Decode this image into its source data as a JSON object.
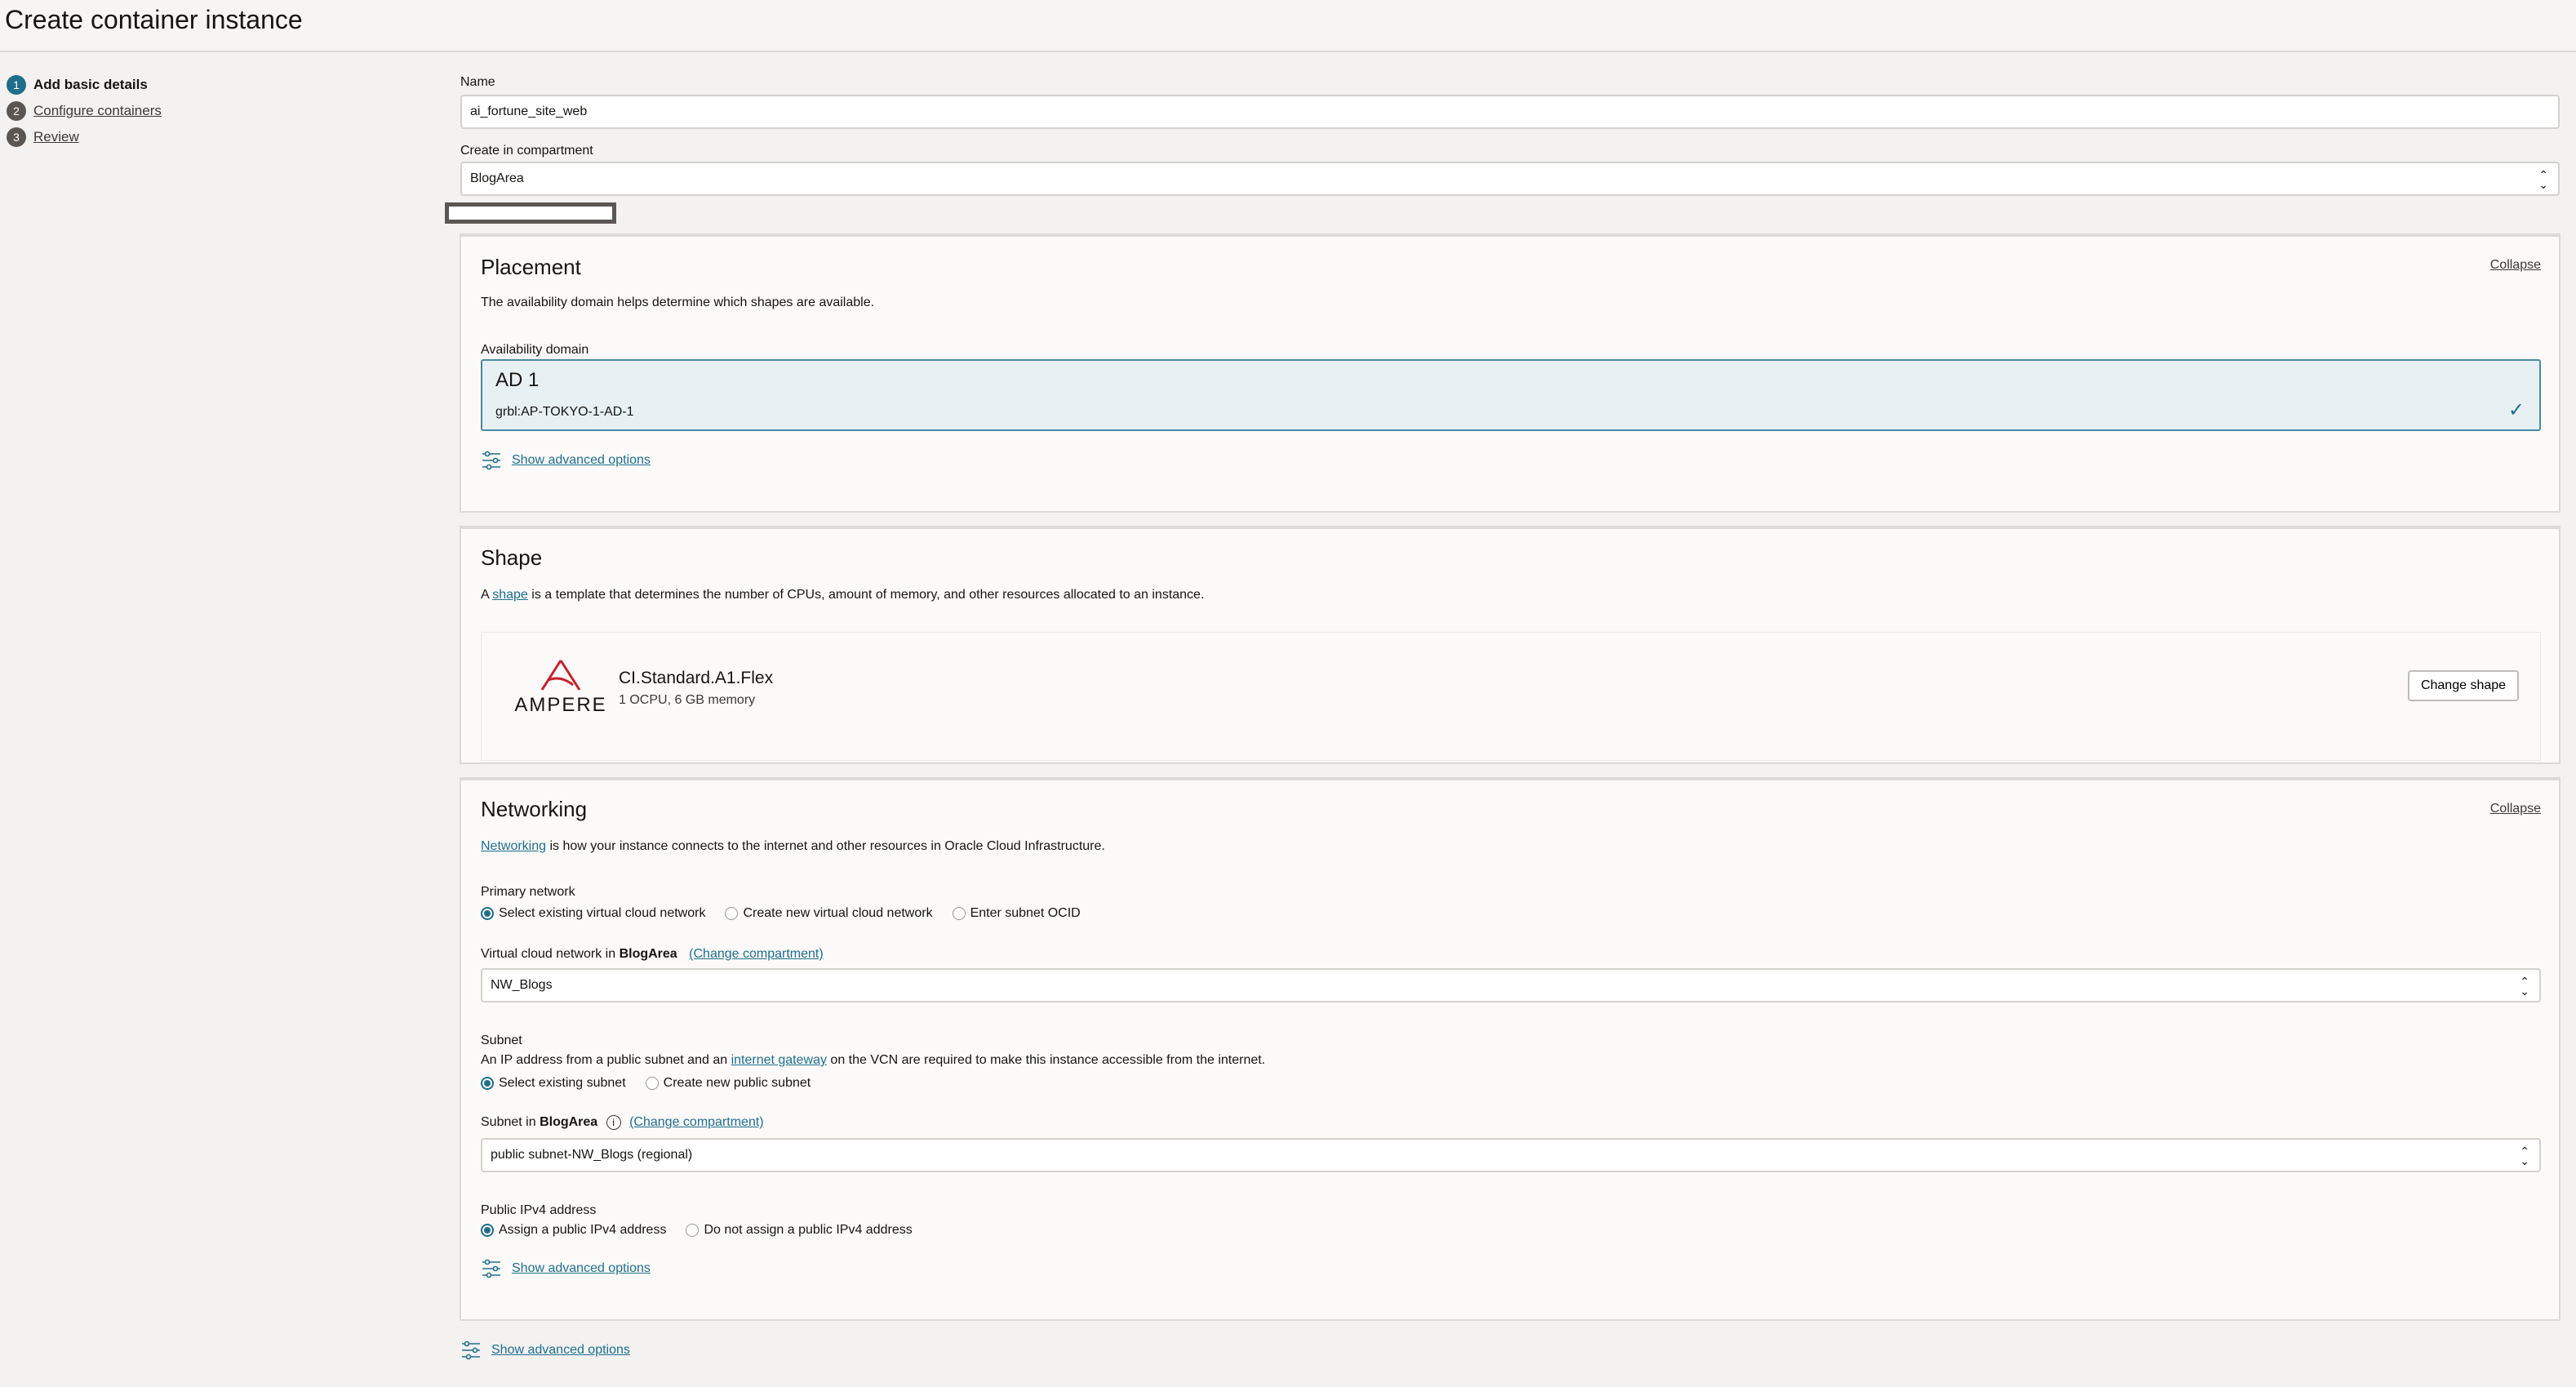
{
  "page": {
    "title": "Create container instance"
  },
  "steps": [
    {
      "num": "1",
      "label": "Add basic details"
    },
    {
      "num": "2",
      "label": "Configure containers"
    },
    {
      "num": "3",
      "label": "Review"
    }
  ],
  "form": {
    "name_label": "Name",
    "name_value": "ai_fortune_site_web",
    "compartment_label": "Create in compartment",
    "compartment_value": "BlogArea"
  },
  "placement": {
    "title": "Placement",
    "collapse": "Collapse",
    "description": "The availability domain helps determine which shapes are available.",
    "ad_label": "Availability domain",
    "ad_name": "AD 1",
    "ad_id": "grbl:AP-TOKYO-1-AD-1",
    "advanced": "Show advanced options"
  },
  "shape": {
    "title": "Shape",
    "desc_prefix": "A ",
    "desc_link": "shape",
    "desc_suffix": " is a template that determines the number of CPUs, amount of memory, and other resources allocated to an instance.",
    "logo_text": "AMPERE",
    "name": "CI.Standard.A1.Flex",
    "spec": "1 OCPU, 6 GB memory",
    "change_button": "Change shape"
  },
  "networking": {
    "title": "Networking",
    "collapse": "Collapse",
    "desc_link": "Networking",
    "desc_suffix": " is how your instance connects to the internet and other resources in Oracle Cloud Infrastructure.",
    "primary_label": "Primary network",
    "primary_options": [
      "Select existing virtual cloud network",
      "Create new virtual cloud network",
      "Enter subnet OCID"
    ],
    "vcn_label_prefix": "Virtual cloud network in ",
    "vcn_compartment": "BlogArea",
    "change_compartment": "(Change compartment)",
    "vcn_value": "NW_Blogs",
    "subnet_label": "Subnet",
    "subnet_desc_prefix": "An IP address from a public subnet and an ",
    "subnet_desc_link": "internet gateway",
    "subnet_desc_suffix": " on the VCN are required to make this instance accessible from the internet.",
    "subnet_options": [
      "Select existing subnet",
      "Create new public subnet"
    ],
    "subnet_in_prefix": "Subnet in ",
    "subnet_compartment": "BlogArea",
    "subnet_value": "public subnet-NW_Blogs (regional)",
    "ipv4_label": "Public IPv4 address",
    "ipv4_options": [
      "Assign a public IPv4 address",
      "Do not assign a public IPv4 address"
    ],
    "advanced": "Show advanced options"
  },
  "footer": {
    "advanced": "Show advanced options"
  },
  "colors": {
    "accent": "#1f6e8c",
    "ampere_red": "#c8202f"
  }
}
